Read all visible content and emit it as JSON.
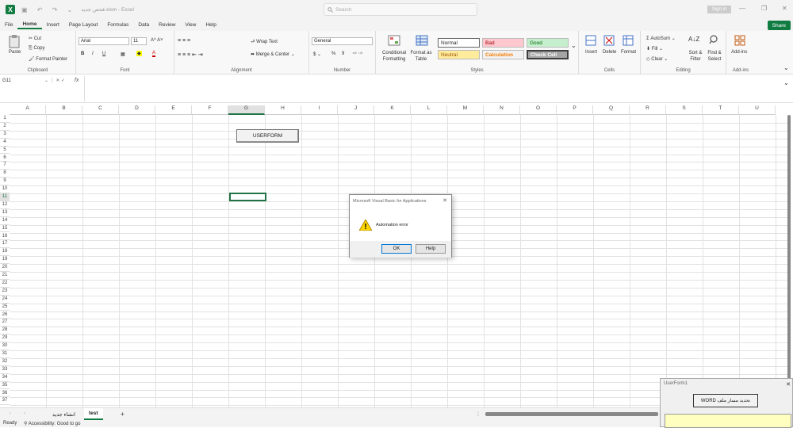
{
  "title": {
    "app_icon": "X",
    "doc_title": "فحص جديد.xlsm - Excel",
    "search_placeholder": "Search",
    "signin": "Sign in",
    "qa_icons": "▣ ↶ ↷ ⌄"
  },
  "window": {
    "minimize": "—",
    "maximize": "❐",
    "close": "✕"
  },
  "menu": [
    "File",
    "Home",
    "Insert",
    "Page Layout",
    "Formulas",
    "Data",
    "Review",
    "View",
    "Help"
  ],
  "share": "Share",
  "ribbon": {
    "clipboard": {
      "label": "Clipboard",
      "paste": "Paste",
      "cut": "Cut",
      "copy": "Copy",
      "painter": "Format Painter"
    },
    "font": {
      "label": "Font",
      "name": "Arial",
      "size": "11",
      "grow": "A^ A˅",
      "b": "B",
      "i": "I",
      "u": "U"
    },
    "alignment": {
      "label": "Alignment",
      "wrap": "Wrap Text",
      "merge": "Merge & Center"
    },
    "number": {
      "label": "Number",
      "format": "General",
      "pct": "%",
      "comma": "9"
    },
    "styles": {
      "label": "Styles",
      "conditional": "Conditional Formatting",
      "table": "Format as Table",
      "normal": "Normal",
      "bad": "Bad",
      "good": "Good",
      "neutral": "Neutral",
      "calc": "Calculation",
      "check": "Check Cell"
    },
    "cells": {
      "label": "Cells",
      "insert": "Insert",
      "delete": "Delete",
      "format": "Format"
    },
    "editing": {
      "label": "Editing",
      "autosum": "AutoSum",
      "fill": "Fill",
      "clear": "Clear",
      "sort": "Sort & Filter",
      "find": "Find & Select"
    },
    "addins": {
      "label": "Add-ins",
      "addins": "Add-ins"
    }
  },
  "formula": {
    "namebox": "G11",
    "fx": "fx",
    "value": ""
  },
  "columns": [
    "A",
    "B",
    "C",
    "D",
    "E",
    "F",
    "G",
    "H",
    "I",
    "J",
    "K",
    "L",
    "M",
    "N",
    "O",
    "P",
    "Q",
    "R",
    "S",
    "T",
    "U"
  ],
  "rows": [
    "1",
    "2",
    "3",
    "4",
    "5",
    "6",
    "7",
    "8",
    "9",
    "10",
    "11",
    "12",
    "13",
    "14",
    "15",
    "16",
    "17",
    "18",
    "19",
    "20",
    "21",
    "22",
    "23",
    "24",
    "25",
    "26",
    "27",
    "28",
    "29",
    "30",
    "31",
    "32",
    "33",
    "34",
    "35",
    "36",
    "37"
  ],
  "sheet_button": "USERFORM",
  "dialog": {
    "title": "Microsoft Visual Basic for Applications",
    "message": "Automation error",
    "ok": "OK",
    "help": "Help",
    "close": "✕"
  },
  "userform": {
    "title": "UserForm1",
    "button": "WORD تحديد مسار ملف",
    "close": "✕"
  },
  "tabs": [
    {
      "label": "انشاء جديد"
    },
    {
      "label": "test"
    }
  ],
  "add_sheet": "+",
  "status": {
    "ready": "Ready",
    "access": "Accessibility: Good to go"
  },
  "colors": {
    "accent": "#107c41",
    "bad_bg": "#ffc7ce",
    "bad_fg": "#9c0006",
    "good_bg": "#c6efce",
    "good_fg": "#006100",
    "neutral_bg": "#ffeb9c",
    "neutral_fg": "#9c5700",
    "calc_bg": "#f2f2f2",
    "calc_fg": "#fa7d00",
    "check_bg": "#a5a5a5"
  }
}
